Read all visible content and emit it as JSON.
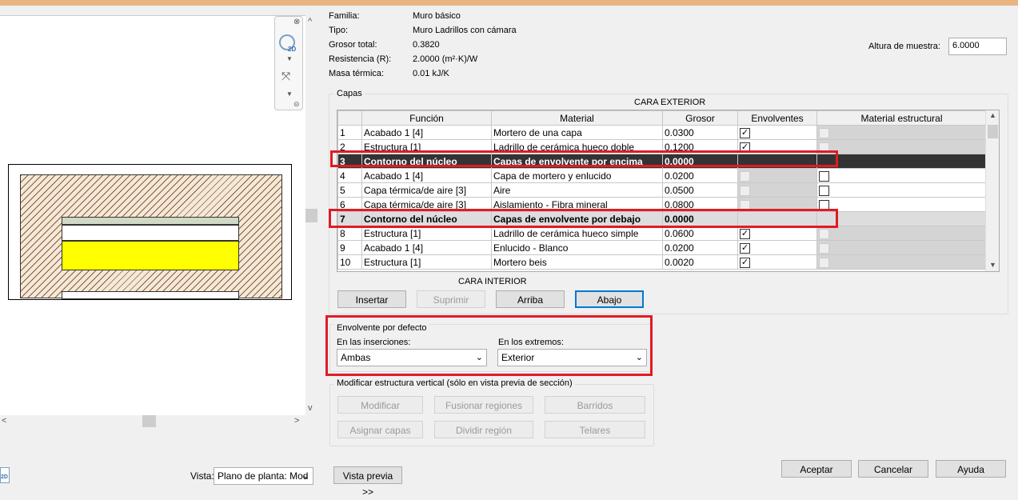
{
  "properties": [
    {
      "label": "Familia:",
      "value": "Muro básico"
    },
    {
      "label": "Tipo:",
      "value": "Muro Ladrillos con cámara"
    },
    {
      "label": "Grosor total:",
      "value": "0.3820"
    },
    {
      "label": "Resistencia (R):",
      "value": "2.0000 (m²·K)/W"
    },
    {
      "label": "Masa térmica:",
      "value": "0.01 kJ/K"
    }
  ],
  "sample_height": {
    "label": "Altura de muestra:",
    "value": "6.0000"
  },
  "layers": {
    "group_label": "Capas",
    "exterior_label": "CARA EXTERIOR",
    "interior_label": "CARA INTERIOR",
    "columns": [
      "",
      "Función",
      "Material",
      "Grosor",
      "Envolventes",
      "Material estructural"
    ],
    "rows": [
      {
        "num": "1",
        "function": "Acabado 1 [4]",
        "material": "Mortero de una capa",
        "thickness": "0.0300",
        "wraps": "checked",
        "structural": "disabled"
      },
      {
        "num": "2",
        "function": "Estructura [1]",
        "material": "Ladrillo de cerámica hueco doble",
        "thickness": "0.1200",
        "wraps": "checked",
        "structural": "disabled"
      },
      {
        "num": "3",
        "function": "Contorno del núcleo",
        "material": "Capas de envolvente por encima",
        "thickness": "0.0000",
        "wraps": "",
        "structural": ""
      },
      {
        "num": "4",
        "function": "Acabado 1 [4]",
        "material": "Capa de mortero y enlucido",
        "thickness": "0.0200",
        "wraps": "disabled",
        "structural": "unchecked"
      },
      {
        "num": "5",
        "function": "Capa térmica/de aire [3]",
        "material": "Aire",
        "thickness": "0.0500",
        "wraps": "disabled",
        "structural": "unchecked"
      },
      {
        "num": "6",
        "function": "Capa térmica/de aire [3]",
        "material": "Aislamiento - Fibra mineral",
        "thickness": "0.0800",
        "wraps": "disabled",
        "structural": "unchecked"
      },
      {
        "num": "7",
        "function": "Contorno del núcleo",
        "material": "Capas de envolvente por debajo",
        "thickness": "0.0000",
        "wraps": "",
        "structural": ""
      },
      {
        "num": "8",
        "function": "Estructura [1]",
        "material": "Ladrillo de cerámica hueco simple",
        "thickness": "0.0600",
        "wraps": "checked",
        "structural": "disabled"
      },
      {
        "num": "9",
        "function": "Acabado 1 [4]",
        "material": "Enlucido - Blanco",
        "thickness": "0.0200",
        "wraps": "checked",
        "structural": "disabled"
      },
      {
        "num": "10",
        "function": "Estructura [1]",
        "material": "Mortero beis",
        "thickness": "0.0020",
        "wraps": "checked",
        "structural": "disabled"
      }
    ],
    "buttons": {
      "insert": "Insertar",
      "delete": "Suprimir",
      "up": "Arriba",
      "down": "Abajo"
    }
  },
  "default_wrapping": {
    "title": "Envolvente por defecto",
    "inserts_label": "En las inserciones:",
    "inserts_value": "Ambas",
    "ends_label": "En los extremos:",
    "ends_value": "Exterior"
  },
  "vertical_structure": {
    "title": "Modificar estructura vertical (sólo en vista previa de sección)",
    "buttons": [
      "Modificar",
      "Fusionar regiones",
      "Barridos",
      "Asignar capas",
      "Dividir región",
      "Telares"
    ]
  },
  "footer": {
    "view_label": "Vista:",
    "view_value": "Plano de planta: Mod",
    "preview_button": "Vista previa >>",
    "ok": "Aceptar",
    "cancel": "Cancelar",
    "help": "Ayuda"
  },
  "icons": {
    "navbar_2d": "2D",
    "footer_2d": "2D"
  }
}
